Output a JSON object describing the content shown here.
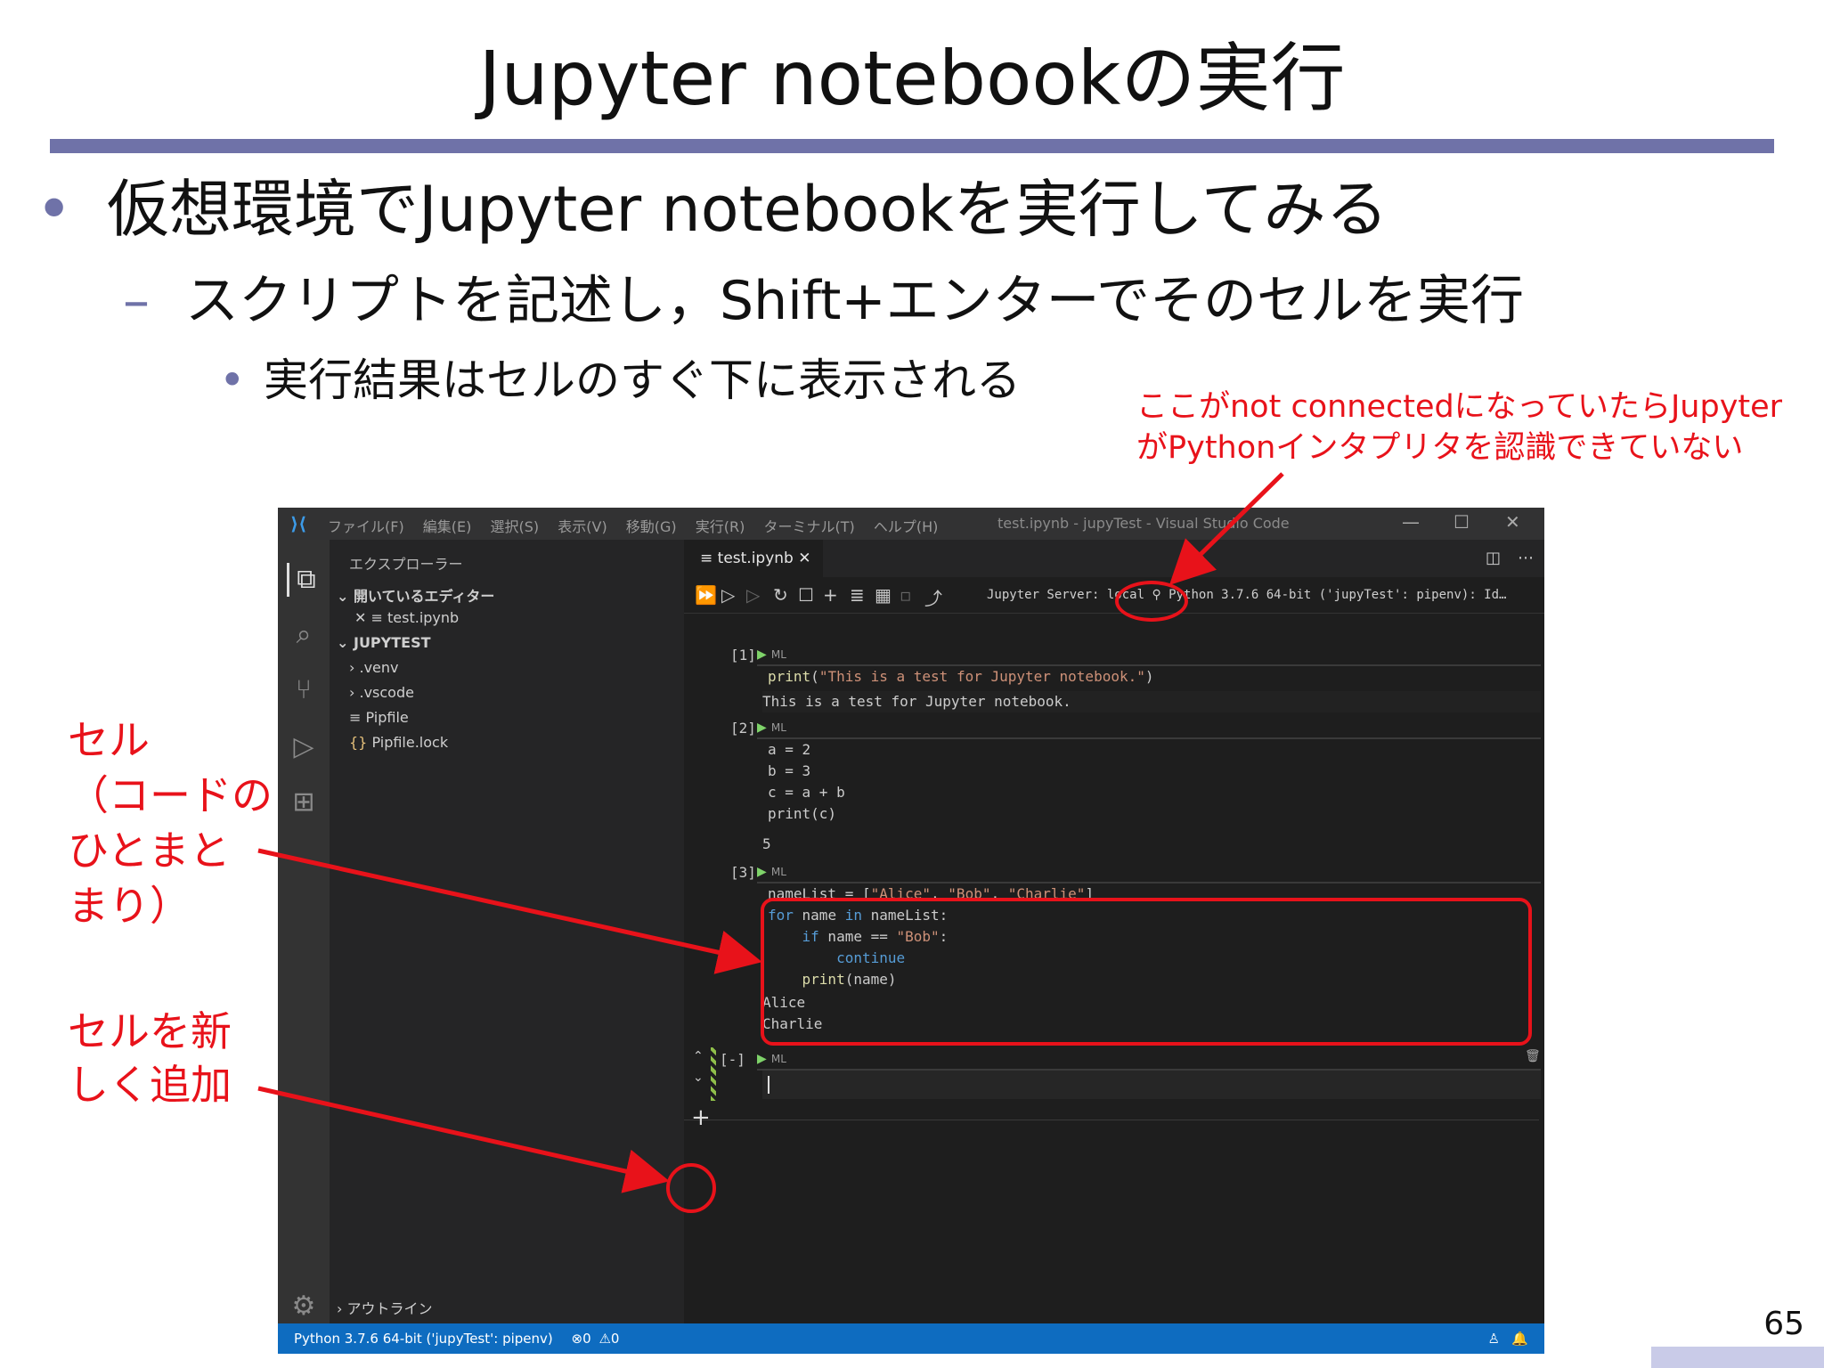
{
  "slide": {
    "title": "Jupyter notebookの実行",
    "bullet1": "仮想環境でJupyter notebookを実行してみる",
    "bullet2": "スクリプトを記述し，Shift+エンターでそのセルを実行",
    "bullet3": "実行結果はセルのすぐ下に表示される",
    "page_number": "65"
  },
  "annotations": {
    "server_note_line1": "ここがnot connectedになっていたらJupyter",
    "server_note_line2": "がPythonインタプリタを認識できていない",
    "cell_note": [
      "セル",
      "（コードの",
      "ひとまと",
      "まり）"
    ],
    "add_note": [
      "セルを新",
      "しく追加"
    ]
  },
  "vscode": {
    "menu": [
      "ファイル(F)",
      "編集(E)",
      "選択(S)",
      "表示(V)",
      "移動(G)",
      "実行(R)",
      "ターミナル(T)",
      "ヘルプ(H)"
    ],
    "window_title": "test.ipynb - jupyTest - Visual Studio Code",
    "explorer_title": "エクスプローラー",
    "open_editors": "開いているエディター",
    "open_file": "test.ipynb",
    "project": "JUPYTEST",
    "tree": [
      ".venv",
      ".vscode",
      "Pipfile",
      "Pipfile.lock"
    ],
    "outline": "アウトライン",
    "tab": "test.ipynb",
    "server_label": "Jupyter Server:",
    "server_value": "local",
    "kernel": "Python 3.7.6 64-bit ('jupyTest': pipenv): Id…",
    "cells": [
      {
        "num": "[1]",
        "code": [
          "print(\"This is a test for Jupyter notebook.\")"
        ],
        "output": [
          "This is a test for Jupyter notebook."
        ]
      },
      {
        "num": "[2]",
        "code": [
          "a = 2",
          "b = 3",
          "c = a + b",
          "print(c)"
        ],
        "output": [
          "5"
        ]
      },
      {
        "num": "[3]",
        "code": [
          "nameList = [\"Alice\", \"Bob\", \"Charlie\"]",
          "for name in nameList:",
          "    if name == \"Bob\":",
          "        continue",
          "    print(name)"
        ],
        "output": [
          "Alice",
          "Charlie"
        ]
      },
      {
        "num": "[-]",
        "code": [
          ""
        ],
        "output": []
      }
    ],
    "cell_lang": "ML",
    "status_left": "Python 3.7.6 64-bit ('jupyTest': pipenv)",
    "status_errors": "0",
    "status_warnings": "0"
  }
}
